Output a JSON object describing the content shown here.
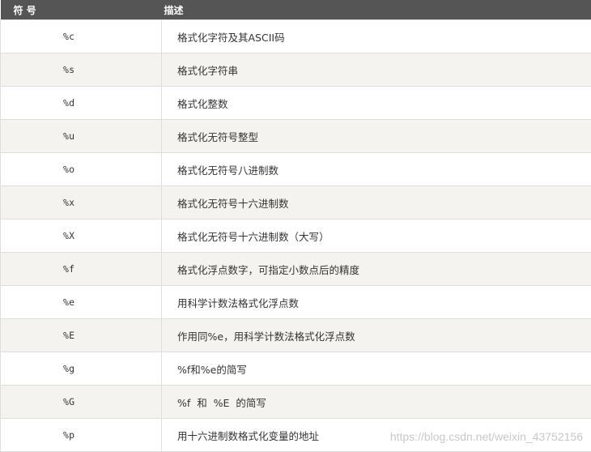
{
  "table": {
    "headers": {
      "symbol": "符 号",
      "description": "描述"
    },
    "rows": [
      {
        "symbol": "%c",
        "description": "格式化字符及其ASCII码"
      },
      {
        "symbol": "%s",
        "description": "格式化字符串"
      },
      {
        "symbol": "%d",
        "description": "格式化整数"
      },
      {
        "symbol": "%u",
        "description": "格式化无符号整型"
      },
      {
        "symbol": "%o",
        "description": "格式化无符号八进制数"
      },
      {
        "symbol": "%x",
        "description": "格式化无符号十六进制数"
      },
      {
        "symbol": "%X",
        "description": "格式化无符号十六进制数（大写）"
      },
      {
        "symbol": "%f",
        "description": "格式化浮点数字，可指定小数点后的精度"
      },
      {
        "symbol": "%e",
        "description": "用科学计数法格式化浮点数"
      },
      {
        "symbol": "%E",
        "description": "作用同%e，用科学计数法格式化浮点数"
      },
      {
        "symbol": "%g",
        "description": "%f和%e的简写"
      },
      {
        "symbol": "%G",
        "description": "%f  和  %E  的简写"
      },
      {
        "symbol": "%p",
        "description": "用十六进制数格式化变量的地址"
      }
    ]
  },
  "watermark": "https://blog.csdn.net/weixin_43752156"
}
